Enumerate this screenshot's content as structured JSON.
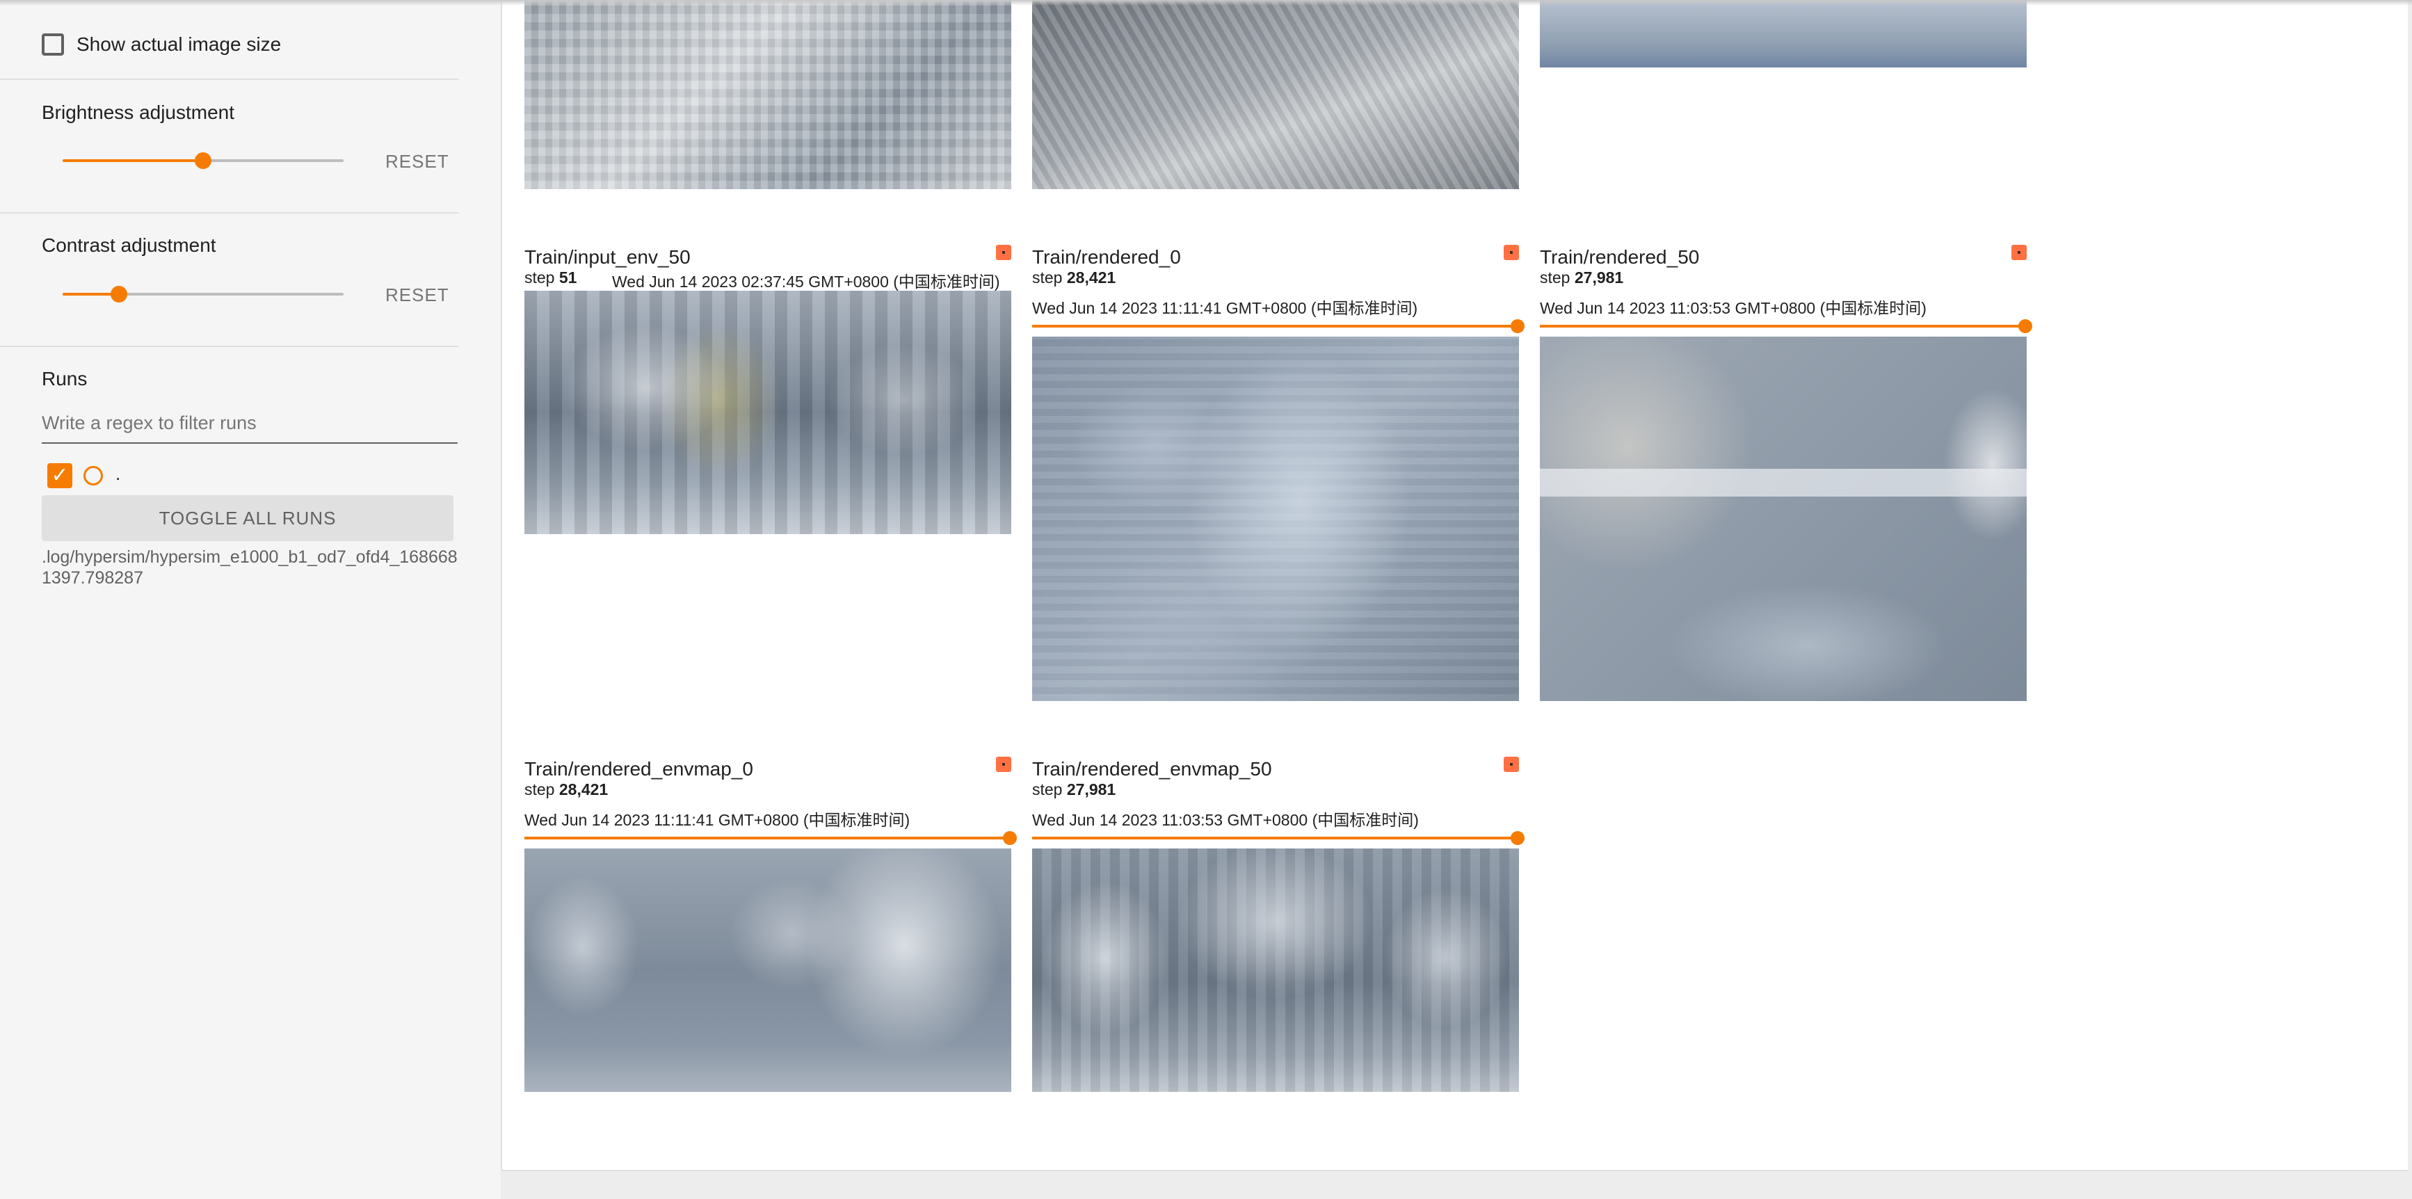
{
  "sidebar": {
    "show_actual_size_label": "Show actual image size",
    "brightness": {
      "label": "Brightness adjustment",
      "value_fraction": 0.5,
      "reset_label": "RESET"
    },
    "contrast": {
      "label": "Contrast adjustment",
      "value_fraction": 0.2,
      "reset_label": "RESET"
    },
    "runs": {
      "title": "Runs",
      "filter_placeholder": "Write a regex to filter runs",
      "run_name": ".",
      "toggle_all_label": "TOGGLE ALL RUNS",
      "run_path": ".log/hypersim/hypersim_e1000_b1_od7_ofd4_1686681397.798287"
    }
  },
  "cards": [
    {
      "title": "Train/input_env_50",
      "step_label": "step",
      "step_value": "51",
      "time": "Wed Jun 14 2023 02:37:45 GMT+0800 (中国标准时间)"
    },
    {
      "title": "Train/rendered_0",
      "step_label": "step",
      "step_value": "28,421",
      "time": "Wed Jun 14 2023 11:11:41 GMT+0800 (中国标准时间)"
    },
    {
      "title": "Train/rendered_50",
      "step_label": "step",
      "step_value": "27,981",
      "time": "Wed Jun 14 2023 11:03:53 GMT+0800 (中国标准时间)"
    },
    {
      "title": "Train/rendered_envmap_0",
      "step_label": "step",
      "step_value": "28,421",
      "time": "Wed Jun 14 2023 11:11:41 GMT+0800 (中国标准时间)"
    },
    {
      "title": "Train/rendered_envmap_50",
      "step_label": "step",
      "step_value": "27,981",
      "time": "Wed Jun 14 2023 11:03:53 GMT+0800 (中国标准时间)"
    }
  ],
  "colors": {
    "accent": "#f57c00",
    "menu_badge": "#ff7043",
    "sidebar_bg": "#f5f5f5"
  }
}
